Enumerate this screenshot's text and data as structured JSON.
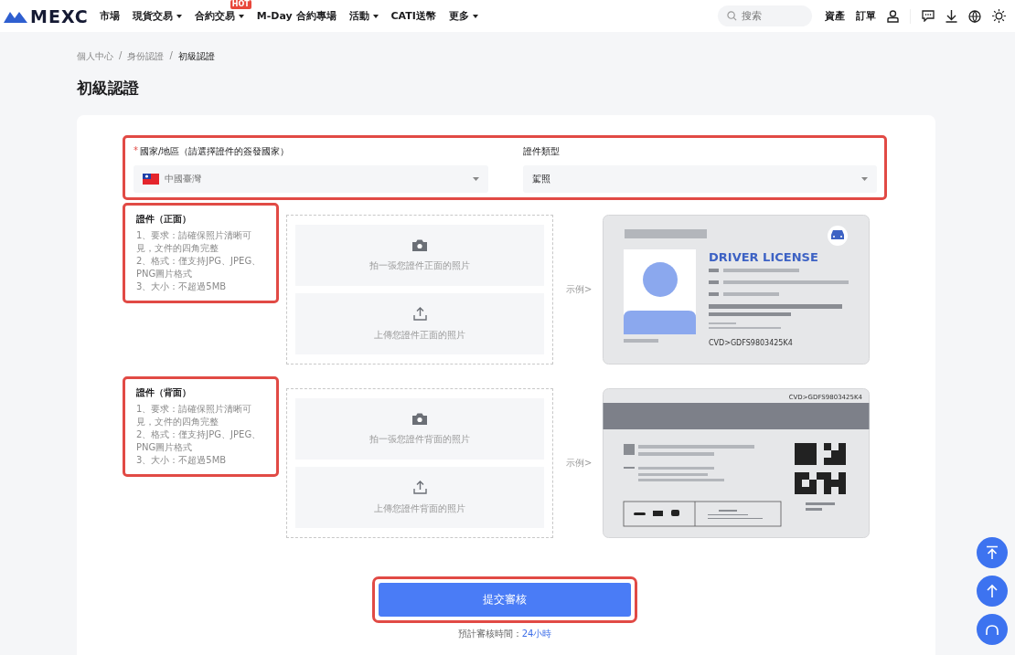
{
  "nav": {
    "logo": "MEXC",
    "items": [
      {
        "label": "市場",
        "dropdown": false
      },
      {
        "label": "現貨交易",
        "dropdown": true
      },
      {
        "label": "合約交易",
        "dropdown": true,
        "badge": "HOT"
      },
      {
        "label": "M-Day 合約專場",
        "dropdown": false
      },
      {
        "label": "活動",
        "dropdown": true
      },
      {
        "label": "CATI送幣",
        "dropdown": false
      },
      {
        "label": "更多",
        "dropdown": true
      }
    ],
    "search": {
      "placeholder": "搜索"
    },
    "links": [
      "資產",
      "訂單"
    ]
  },
  "breadcrumb": {
    "separator": "/",
    "items": [
      {
        "label": "個人中心",
        "current": false
      },
      {
        "label": "身份認證",
        "current": false
      },
      {
        "label": "初級認證",
        "current": true
      }
    ]
  },
  "title": "初級認證",
  "form": {
    "highlighted": true,
    "required_marker": "*",
    "country": {
      "label": "國家/地區（請選擇證件的簽發國家）",
      "required": true,
      "value": "中國臺灣"
    },
    "doc_type": {
      "label": "證件類型",
      "required": false,
      "value": "駕照"
    }
  },
  "sides": [
    {
      "kind": "front",
      "highlighted": true,
      "title": "證件（正面）",
      "requirements": [
        "1、要求：請確保照片清晰可見，文件的四角完整",
        "2、格式：僅支持JPG、JPEG、PNG圖片格式",
        "3、大小：不超過5MB"
      ],
      "take_photo": "拍一張您證件正面的照片",
      "upload": "上傳您證件正面的照片",
      "example_link": "示例>",
      "sample": {
        "heading": "DRIVER LICENSE",
        "code": "CVD>GDFS9803425K4"
      }
    },
    {
      "kind": "back",
      "highlighted": true,
      "title": "證件（背面）",
      "requirements": [
        "1、要求：請確保照片清晰可見，文件的四角完整",
        "2、格式：僅支持JPG、JPEG、PNG圖片格式",
        "3、大小：不超過5MB"
      ],
      "take_photo": "拍一張您證件背面的照片",
      "upload": "上傳您證件背面的照片",
      "example_link": "示例>",
      "sample": {
        "code": "CVD>GDFS9803425K4"
      }
    }
  ],
  "submit": {
    "label": "提交審核",
    "highlighted": true,
    "eta_label": "預計審核時間：",
    "eta_value": "24小時"
  }
}
